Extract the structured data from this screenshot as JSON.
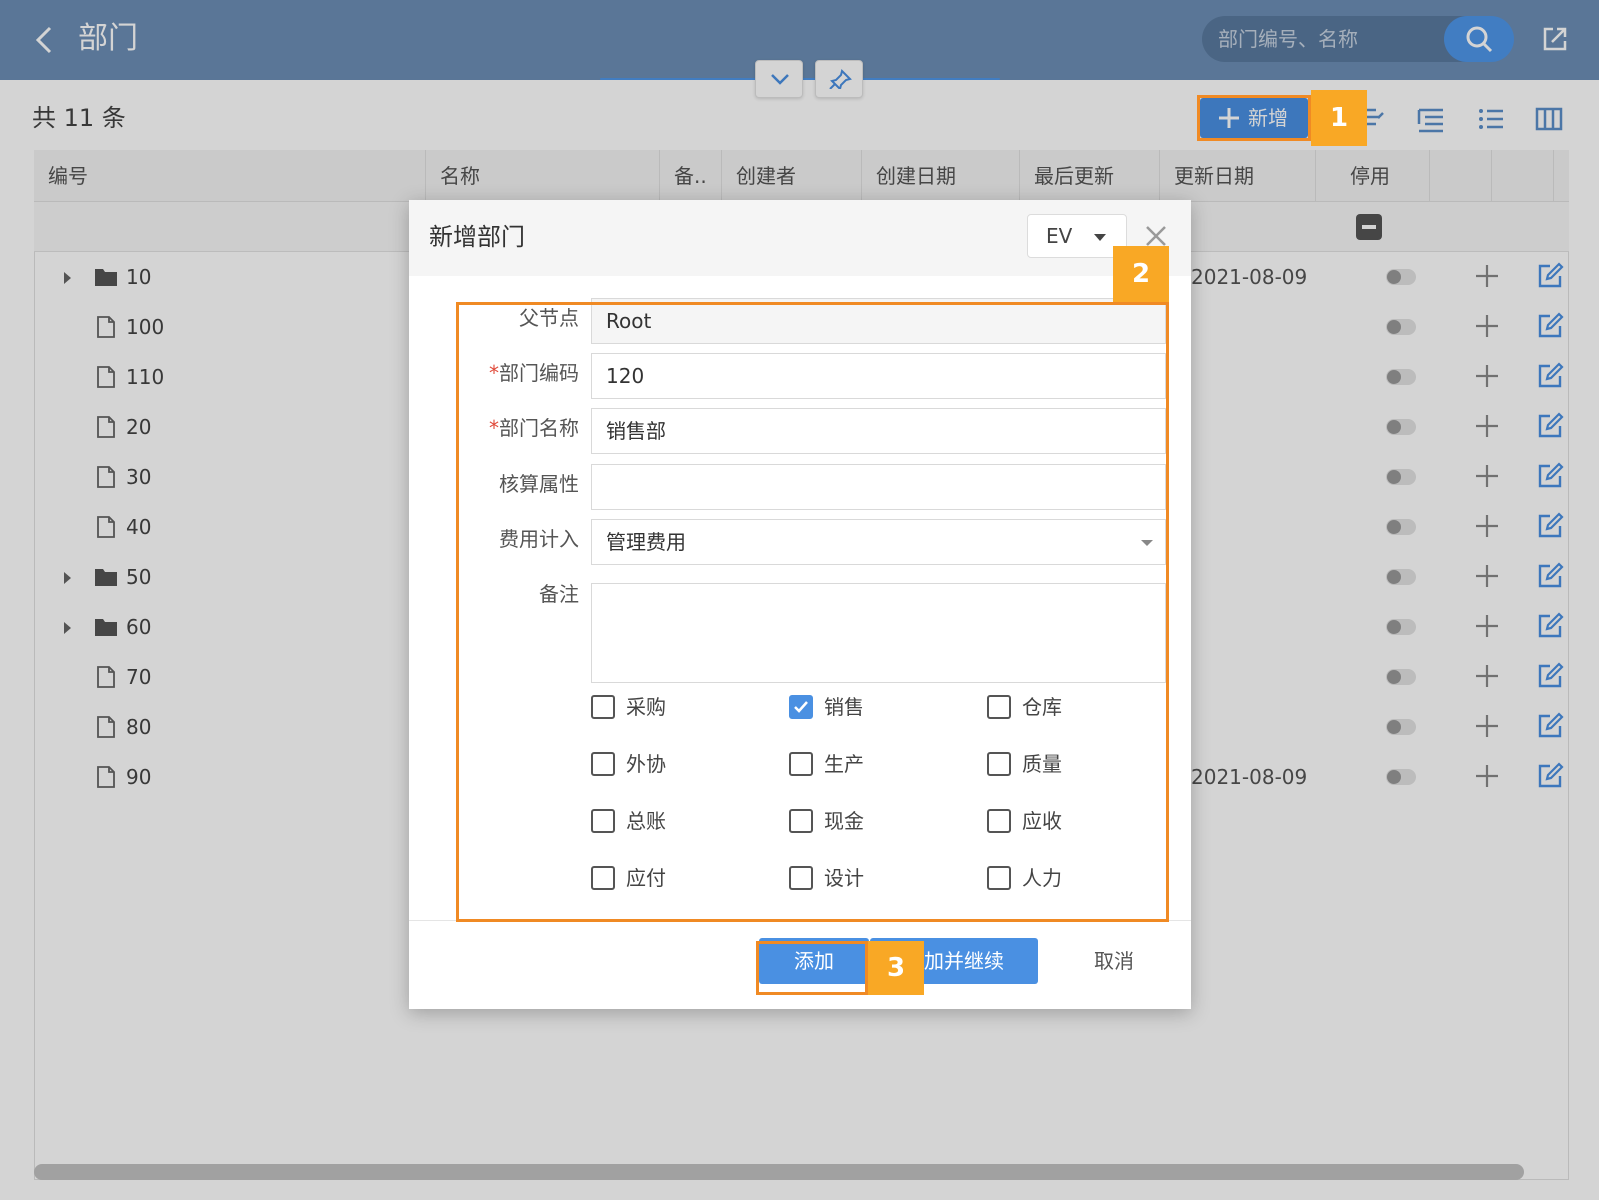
{
  "header": {
    "title": "部门",
    "search_placeholder": "部门编号、名称"
  },
  "toolbar": {
    "record_count": "共 11 条",
    "add_label": "新增"
  },
  "table": {
    "columns": [
      "编号",
      "名称",
      "备..",
      "创建者",
      "创建日期",
      "最后更新",
      "更新日期",
      "停用"
    ],
    "rows": [
      {
        "code": "10",
        "type": "folder",
        "expandable": true,
        "update_date": "2021-08-09"
      },
      {
        "code": "100",
        "type": "file",
        "expandable": false,
        "update_date": ""
      },
      {
        "code": "110",
        "type": "file",
        "expandable": false,
        "update_date": ""
      },
      {
        "code": "20",
        "type": "file",
        "expandable": false,
        "update_date": ""
      },
      {
        "code": "30",
        "type": "file",
        "expandable": false,
        "update_date": ""
      },
      {
        "code": "40",
        "type": "file",
        "expandable": false,
        "update_date": ""
      },
      {
        "code": "50",
        "type": "folder",
        "expandable": true,
        "update_date": ""
      },
      {
        "code": "60",
        "type": "folder",
        "expandable": true,
        "update_date": ""
      },
      {
        "code": "70",
        "type": "file",
        "expandable": false,
        "update_date": ""
      },
      {
        "code": "80",
        "type": "file",
        "expandable": false,
        "update_date": ""
      },
      {
        "code": "90",
        "type": "file",
        "expandable": false,
        "update_date": "2021-08-09"
      }
    ]
  },
  "dialog": {
    "title": "新增部门",
    "language": "EV",
    "fields": {
      "parent": {
        "label": "父节点",
        "value": "Root"
      },
      "code": {
        "label": "部门编码",
        "value": "120",
        "required": true
      },
      "name": {
        "label": "部门名称",
        "value": "销售部",
        "required": true
      },
      "accounting": {
        "label": "核算属性",
        "value": ""
      },
      "expense": {
        "label": "费用计入",
        "value": "管理费用"
      },
      "remark": {
        "label": "备注",
        "value": ""
      }
    },
    "checkboxes": [
      {
        "label": "采购",
        "checked": false
      },
      {
        "label": "销售",
        "checked": true
      },
      {
        "label": "仓库",
        "checked": false
      },
      {
        "label": "外协",
        "checked": false
      },
      {
        "label": "生产",
        "checked": false
      },
      {
        "label": "质量",
        "checked": false
      },
      {
        "label": "总账",
        "checked": false
      },
      {
        "label": "现金",
        "checked": false
      },
      {
        "label": "应收",
        "checked": false
      },
      {
        "label": "应付",
        "checked": false
      },
      {
        "label": "设计",
        "checked": false
      },
      {
        "label": "人力",
        "checked": false
      }
    ],
    "buttons": {
      "add": "添加",
      "add_continue": "添加并继续",
      "cancel": "取消"
    }
  },
  "callouts": [
    "1",
    "2",
    "3"
  ],
  "colors": {
    "primary": "#4a90e2",
    "header_bg": "#6d8fb6",
    "highlight": "#f08a24",
    "badge": "#f9a825"
  }
}
